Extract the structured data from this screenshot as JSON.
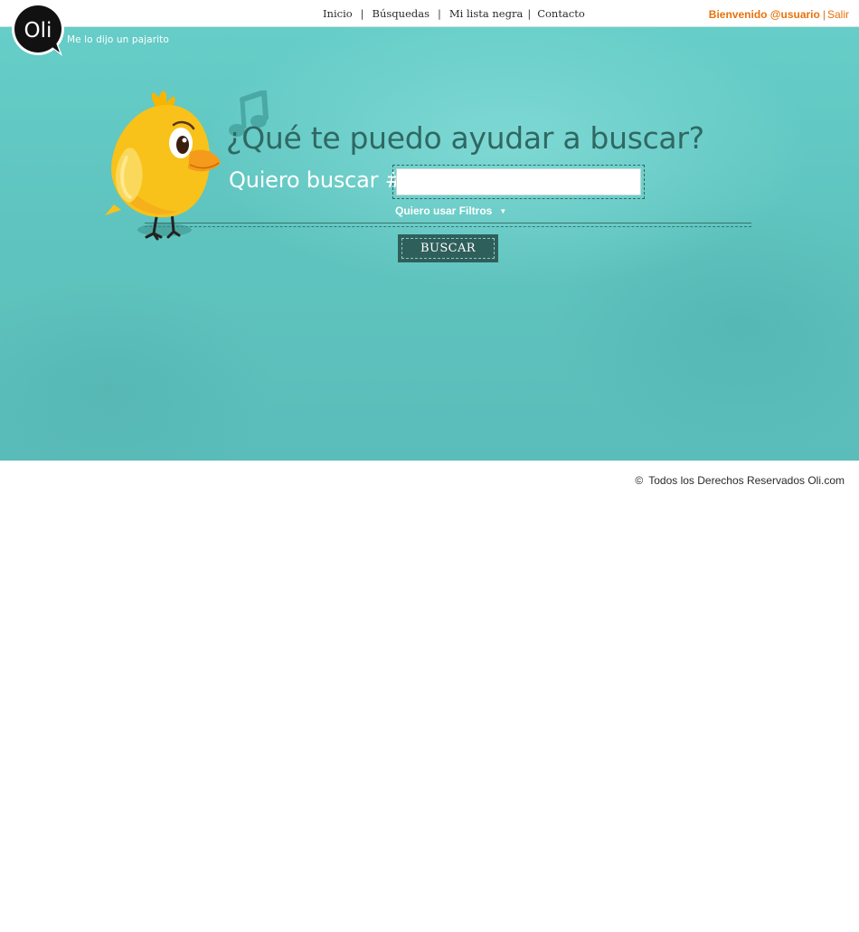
{
  "brand": {
    "logo_text": "Oli",
    "tagline": "Me lo dijo un pajarito"
  },
  "nav": {
    "items": [
      {
        "label": "Inicio"
      },
      {
        "label": "Búsquedas"
      },
      {
        "label": "Mi lista negra"
      },
      {
        "label": "Contacto"
      }
    ],
    "separator": "|"
  },
  "user": {
    "welcome": "Bienvenido @usuario",
    "separator": "|",
    "logout": "Salir"
  },
  "search": {
    "headline": "¿Qué te puedo ayudar a buscar?",
    "label": "Quiero buscar #",
    "input_value": "",
    "placeholder": "",
    "filters_toggle": "Quiero usar Filtros",
    "submit_label": "BUSCAR"
  },
  "footer": {
    "copyright_symbol": "©",
    "text": "Todos los Derechos Reservados Oli.com"
  },
  "icons": {
    "logo": "speech-bubble-logo",
    "bird": "yellow-bird-illustration",
    "note": "music-note-icon",
    "caret": "caret-down-icon"
  },
  "colors": {
    "hero_bg": "#5fc4bf",
    "heading": "#2f6863",
    "button_bg": "#2f5f5b",
    "accent_orange": "#e8720c",
    "bird_yellow": "#f8c21a"
  }
}
